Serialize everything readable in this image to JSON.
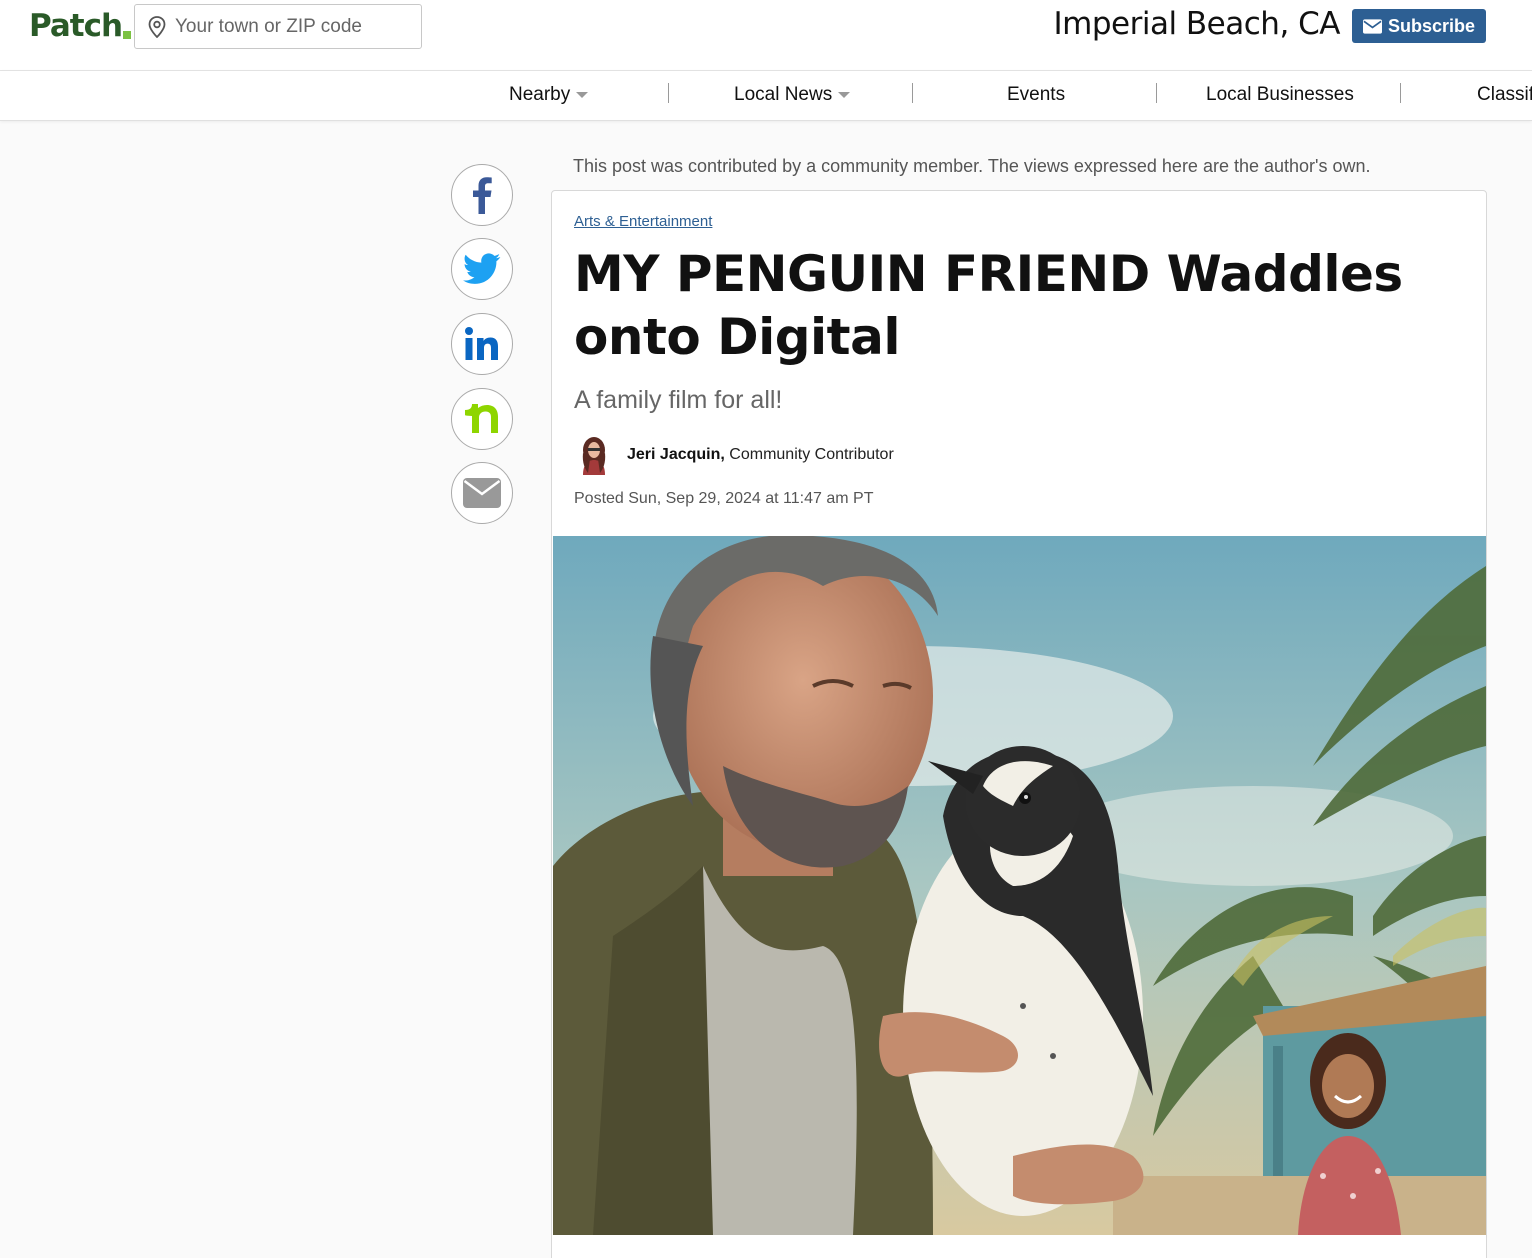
{
  "header": {
    "logo_text": "Patch",
    "search_placeholder": "Your town or ZIP code",
    "town": "Imperial Beach, CA",
    "subscribe_label": "Subscribe"
  },
  "nav": {
    "items": [
      {
        "label": "Nearby"
      },
      {
        "label": "Local News"
      },
      {
        "label": "Events"
      },
      {
        "label": "Local Businesses"
      },
      {
        "label": "Classif"
      }
    ]
  },
  "share": {
    "icons": [
      "facebook-icon",
      "twitter-icon",
      "linkedin-icon",
      "nextdoor-icon",
      "email-icon"
    ]
  },
  "article": {
    "disclaimer": "This post was contributed by a community member. The views expressed here are the author's own.",
    "category": "Arts & Entertainment",
    "headline_line1": "MY PENGUIN FRIEND Waddles",
    "headline_line2": "onto Digital",
    "subhead": "A family film for all!",
    "author": "Jeri Jacquin,",
    "author_role": "Community Contributor",
    "posted": "Posted Sun, Sep 29, 2024 at 11:47 am PT"
  },
  "colors": {
    "brand_green": "#2a5a28",
    "accent_green": "#7cc242",
    "link_blue": "#2d5f93",
    "facebook": "#3b5998",
    "twitter": "#1da1f2",
    "linkedin": "#0a66c2",
    "nextdoor": "#8ed500"
  }
}
